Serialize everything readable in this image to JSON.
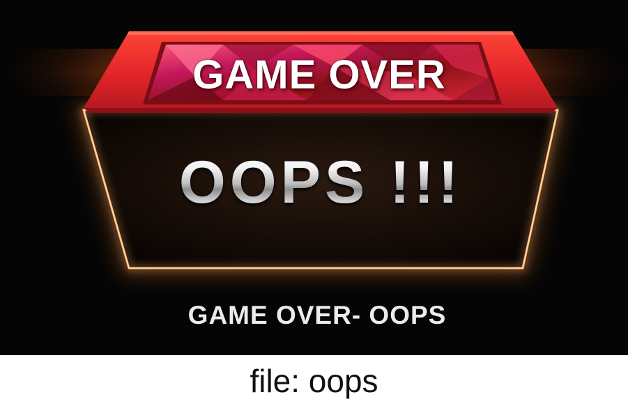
{
  "banner": {
    "title": "GAME OVER"
  },
  "panel": {
    "message": "OOPS !!!"
  },
  "caption": "GAME OVER- OOPS",
  "file_label": "file: oops",
  "colors": {
    "background": "#050505",
    "banner_red": "#e3262a",
    "banner_dark_red": "#8d1018",
    "banner_magenta": "#c2185b",
    "panel_glow": "#ff9a3c",
    "panel_fill": "#1a0f08",
    "caption_text": "#ececec",
    "page_background": "#ffffff"
  }
}
